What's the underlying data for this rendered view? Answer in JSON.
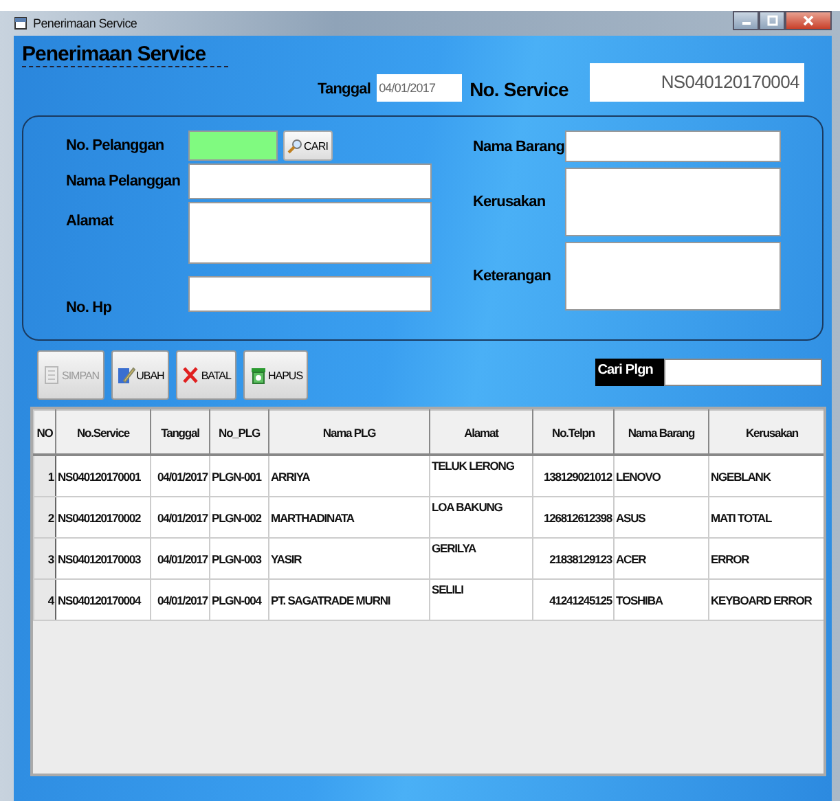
{
  "window": {
    "title": "Penerimaan Service"
  },
  "header": {
    "title": "Penerimaan Service",
    "date_label": "Tanggal",
    "date_value": "04/01/2017",
    "service_label": "No. Service",
    "service_value": "NS040120170004"
  },
  "form": {
    "left": [
      {
        "label": "No. Pelanggan",
        "kind": "lookup"
      },
      {
        "label": "Nama Pelanggan",
        "kind": "line"
      },
      {
        "label": "Alamat",
        "kind": "area"
      },
      {
        "label": "No. Hp",
        "kind": "line"
      }
    ],
    "search_button": "CARI",
    "right": [
      {
        "label": "Nama Barang",
        "kind": "line"
      },
      {
        "label": "Kerusakan",
        "kind": "area"
      },
      {
        "label": "Keterangan",
        "kind": "area"
      }
    ]
  },
  "buttons": [
    {
      "label": "SIMPAN",
      "kind": "save",
      "disabled": true
    },
    {
      "label": "UBAH",
      "kind": "edit",
      "disabled": false
    },
    {
      "label": "BATAL",
      "kind": "cancel",
      "disabled": false
    },
    {
      "label": "HAPUS",
      "kind": "delete",
      "disabled": false
    }
  ],
  "customer_search": {
    "label": "Cari Plgn"
  },
  "table": {
    "columns": [
      "NO",
      "No.Service",
      "Tanggal",
      "No_PLG",
      "Nama PLG",
      "Alamat",
      "No.Telpn",
      "Nama Barang",
      "Kerusakan"
    ],
    "rows": [
      [
        "1",
        "NS040120170001",
        "04/01/2017",
        "PLGN-001",
        "ARRIYA",
        "TELUK LERONG",
        "138129021012",
        "LENOVO",
        "NGEBLANK"
      ],
      [
        "2",
        "NS040120170002",
        "04/01/2017",
        "PLGN-002",
        "MARTHADINATA",
        "LOA BAKUNG",
        "126812612398",
        "ASUS",
        "MATI TOTAL"
      ],
      [
        "3",
        "NS040120170003",
        "04/01/2017",
        "PLGN-003",
        "YASIR",
        "GERILYA",
        "21838129123",
        "ACER",
        "ERROR"
      ],
      [
        "4",
        "NS040120170004",
        "04/01/2017",
        "PLGN-004",
        "PT. SAGATRADE MURNI",
        "SELILI",
        "41241245125",
        "TOSHIBA",
        "KEYBOARD ERROR"
      ]
    ]
  }
}
